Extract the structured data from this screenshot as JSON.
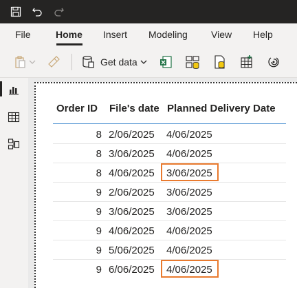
{
  "window": {
    "quick_access": [
      "save-icon",
      "undo-icon",
      "redo-icon"
    ]
  },
  "menu": {
    "items": [
      "File",
      "Home",
      "Insert",
      "Modeling",
      "View",
      "Help"
    ],
    "active": "Home"
  },
  "ribbon": {
    "get_data_label": "Get data",
    "icons": [
      "paste-icon",
      "format-painter-icon",
      "get-data-icon",
      "excel-icon",
      "data-hub-icon",
      "sql-server-icon",
      "enter-data-icon",
      "dataverse-icon"
    ]
  },
  "left_rail": {
    "items": [
      "report-view-icon",
      "table-view-icon",
      "model-view-icon"
    ],
    "active": "report-view-icon"
  },
  "table": {
    "headers": [
      "Order ID",
      "File's date",
      "Planned Delivery Date"
    ],
    "rows": [
      {
        "order_id": "8",
        "file_date": "2/06/2025",
        "planned": "4/06/2025",
        "highlighted": false
      },
      {
        "order_id": "8",
        "file_date": "3/06/2025",
        "planned": "4/06/2025",
        "highlighted": false
      },
      {
        "order_id": "8",
        "file_date": "4/06/2025",
        "planned": "3/06/2025",
        "highlighted": true
      },
      {
        "order_id": "9",
        "file_date": "2/06/2025",
        "planned": "3/06/2025",
        "highlighted": false
      },
      {
        "order_id": "9",
        "file_date": "3/06/2025",
        "planned": "3/06/2025",
        "highlighted": false
      },
      {
        "order_id": "9",
        "file_date": "4/06/2025",
        "planned": "4/06/2025",
        "highlighted": false
      },
      {
        "order_id": "9",
        "file_date": "5/06/2025",
        "planned": "4/06/2025",
        "highlighted": false
      },
      {
        "order_id": "9",
        "file_date": "6/06/2025",
        "planned": "4/06/2025",
        "highlighted": true
      }
    ],
    "highlight_color": "#e97a2e",
    "header_rule_color": "#5b9bd5"
  }
}
